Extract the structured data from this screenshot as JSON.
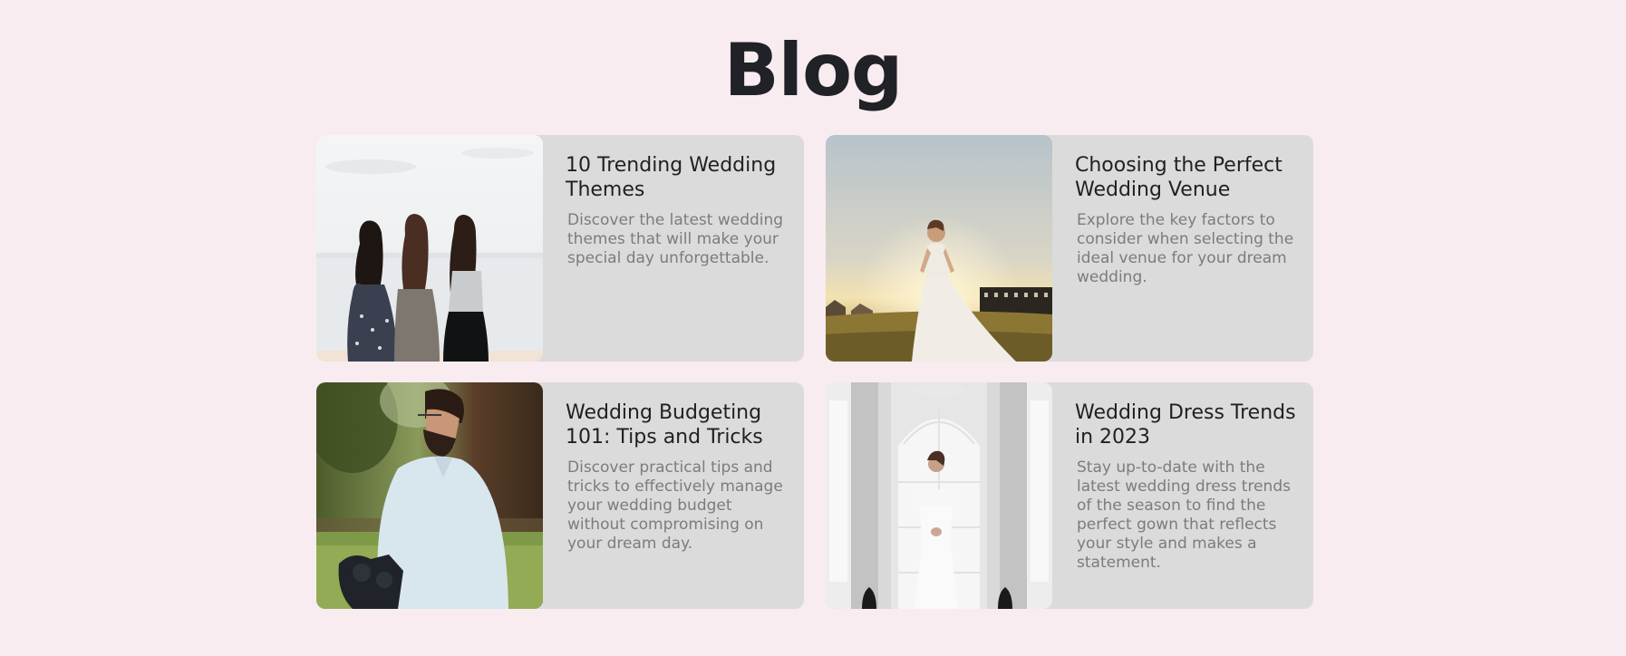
{
  "page": {
    "title": "Blog",
    "background_color": "#f8ecf0",
    "card_color": "#dbdbdb"
  },
  "posts": [
    {
      "title": "10 Trending Wedding Themes",
      "description": "Discover the latest wedding themes that will make your special day unforgettable.",
      "image_alt": "three-women-from-behind-photo"
    },
    {
      "title": "Choosing the Perfect Wedding Venue",
      "description": "Explore the key factors to consider when selecting the ideal venue for your dream wedding.",
      "image_alt": "bride-in-field-at-sunset-photo"
    },
    {
      "title": "Wedding Budgeting 101: Tips and Tricks",
      "description": "Discover practical tips and tricks to effectively manage your wedding budget without compromising on your dream day.",
      "image_alt": "man-with-camera-gimbal-photo"
    },
    {
      "title": "Wedding Dress Trends in 2023",
      "description": "Stay up-to-date with the latest wedding dress trends of the season to find the perfect gown that reflects your style and makes a statement.",
      "image_alt": "bride-in-white-room-photo"
    }
  ]
}
